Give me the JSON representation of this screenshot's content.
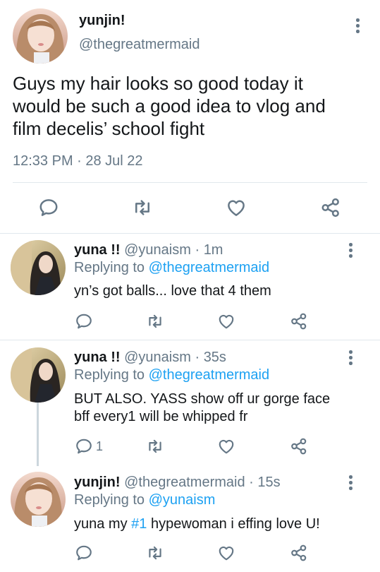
{
  "main_tweet": {
    "display_name": "yunjin!",
    "handle": "@thegreatmermaid",
    "text_lines": [
      "Guys my hair looks so good today it",
      "would be such a good idea to vlog and",
      "film decelis’ school fight"
    ],
    "timestamp": "12:33 PM · 28 Jul 22"
  },
  "replies": [
    {
      "display_name": "yuna !!",
      "handle": "@yunaism",
      "time": "1m",
      "replying_prefix": "Replying to",
      "replying_to": "@thegreatmermaid",
      "text_lines": [
        "yn’s got balls... love that 4 them"
      ],
      "reply_count": ""
    },
    {
      "display_name": "yuna !!",
      "handle": "@yunaism",
      "time": "35s",
      "replying_prefix": "Replying to",
      "replying_to": "@thegreatmermaid",
      "text_lines": [
        "BUT ALSO. YASS show off ur gorge face",
        "bff every1 will be whipped fr"
      ],
      "reply_count": "1"
    },
    {
      "display_name": "yunjin!",
      "handle": "@thegreatmermaid",
      "time": "15s",
      "replying_prefix": "Replying to",
      "replying_to": "@yunaism",
      "text_before": "yuna my ",
      "hashtag": "#1",
      "text_after": " hypewoman i effing love U!",
      "reply_count": ""
    }
  ],
  "separator": " · ",
  "icons": {
    "reply": "reply-icon",
    "retweet": "retweet-icon",
    "like": "heart-icon",
    "share": "share-icon",
    "more": "more-vertical-icon"
  },
  "colors": {
    "link": "#1da1f2",
    "muted": "#657786",
    "text": "#14171a",
    "divider": "#e1e8ed"
  }
}
